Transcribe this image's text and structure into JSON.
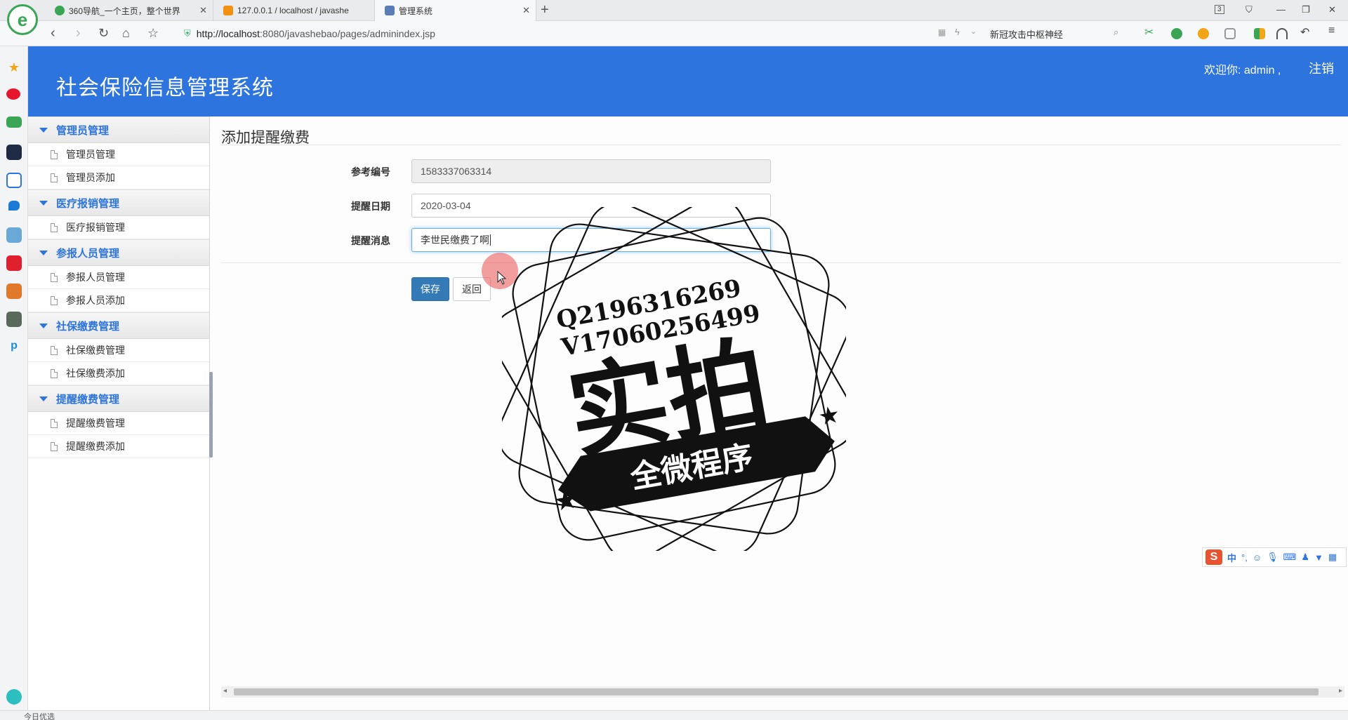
{
  "browser": {
    "tabs": [
      {
        "label": "360导航_一个主页，整个世界",
        "favicon_color": "#3aa655",
        "active": false
      },
      {
        "label": "127.0.0.1 / localhost / javashe",
        "favicon_color": "#f29111",
        "active": false
      },
      {
        "label": "管理系统",
        "favicon_color": "#5a7db5",
        "active": true
      }
    ],
    "tab_count_badge": "3",
    "url_host": "http://localhost",
    "url_rest": ":8080/javashebao/pages/adminindex.jsp",
    "search_text": "新冠攻击中枢神经"
  },
  "app": {
    "title": "社会保险信息管理系统",
    "welcome": "欢迎你: admin ,",
    "logout_label": "注销",
    "header_color": "#2d74de"
  },
  "sidebar": {
    "groups": [
      {
        "label": "管理员管理",
        "items": [
          "管理员管理",
          "管理员添加"
        ]
      },
      {
        "label": "医疗报销管理",
        "items": [
          "医疗报销管理"
        ]
      },
      {
        "label": "参报人员管理",
        "items": [
          "参报人员管理",
          "参报人员添加"
        ]
      },
      {
        "label": "社保缴费管理",
        "items": [
          "社保缴费管理",
          "社保缴费添加"
        ]
      },
      {
        "label": "提醒缴费管理",
        "items": [
          "提醒缴费管理",
          "提醒缴费添加"
        ]
      }
    ]
  },
  "form": {
    "page_title": "添加提醒缴费",
    "fields": [
      {
        "label": "参考编号",
        "value": "1583337063314",
        "readonly": true
      },
      {
        "label": "提醒日期",
        "value": "2020-03-04",
        "readonly": false
      },
      {
        "label": "提醒消息",
        "value": "李世民缴费了啊",
        "readonly": false,
        "focused": true
      }
    ],
    "save_label": "保存",
    "back_label": "返回"
  },
  "watermark": {
    "line1": "Q2196316269",
    "line2": "V17060256499",
    "main_text": "实拍",
    "banner_text": "全微程序"
  },
  "ime": {
    "logo": "S",
    "mode": "中"
  },
  "statusbar": {
    "left_text": "今日优选"
  }
}
